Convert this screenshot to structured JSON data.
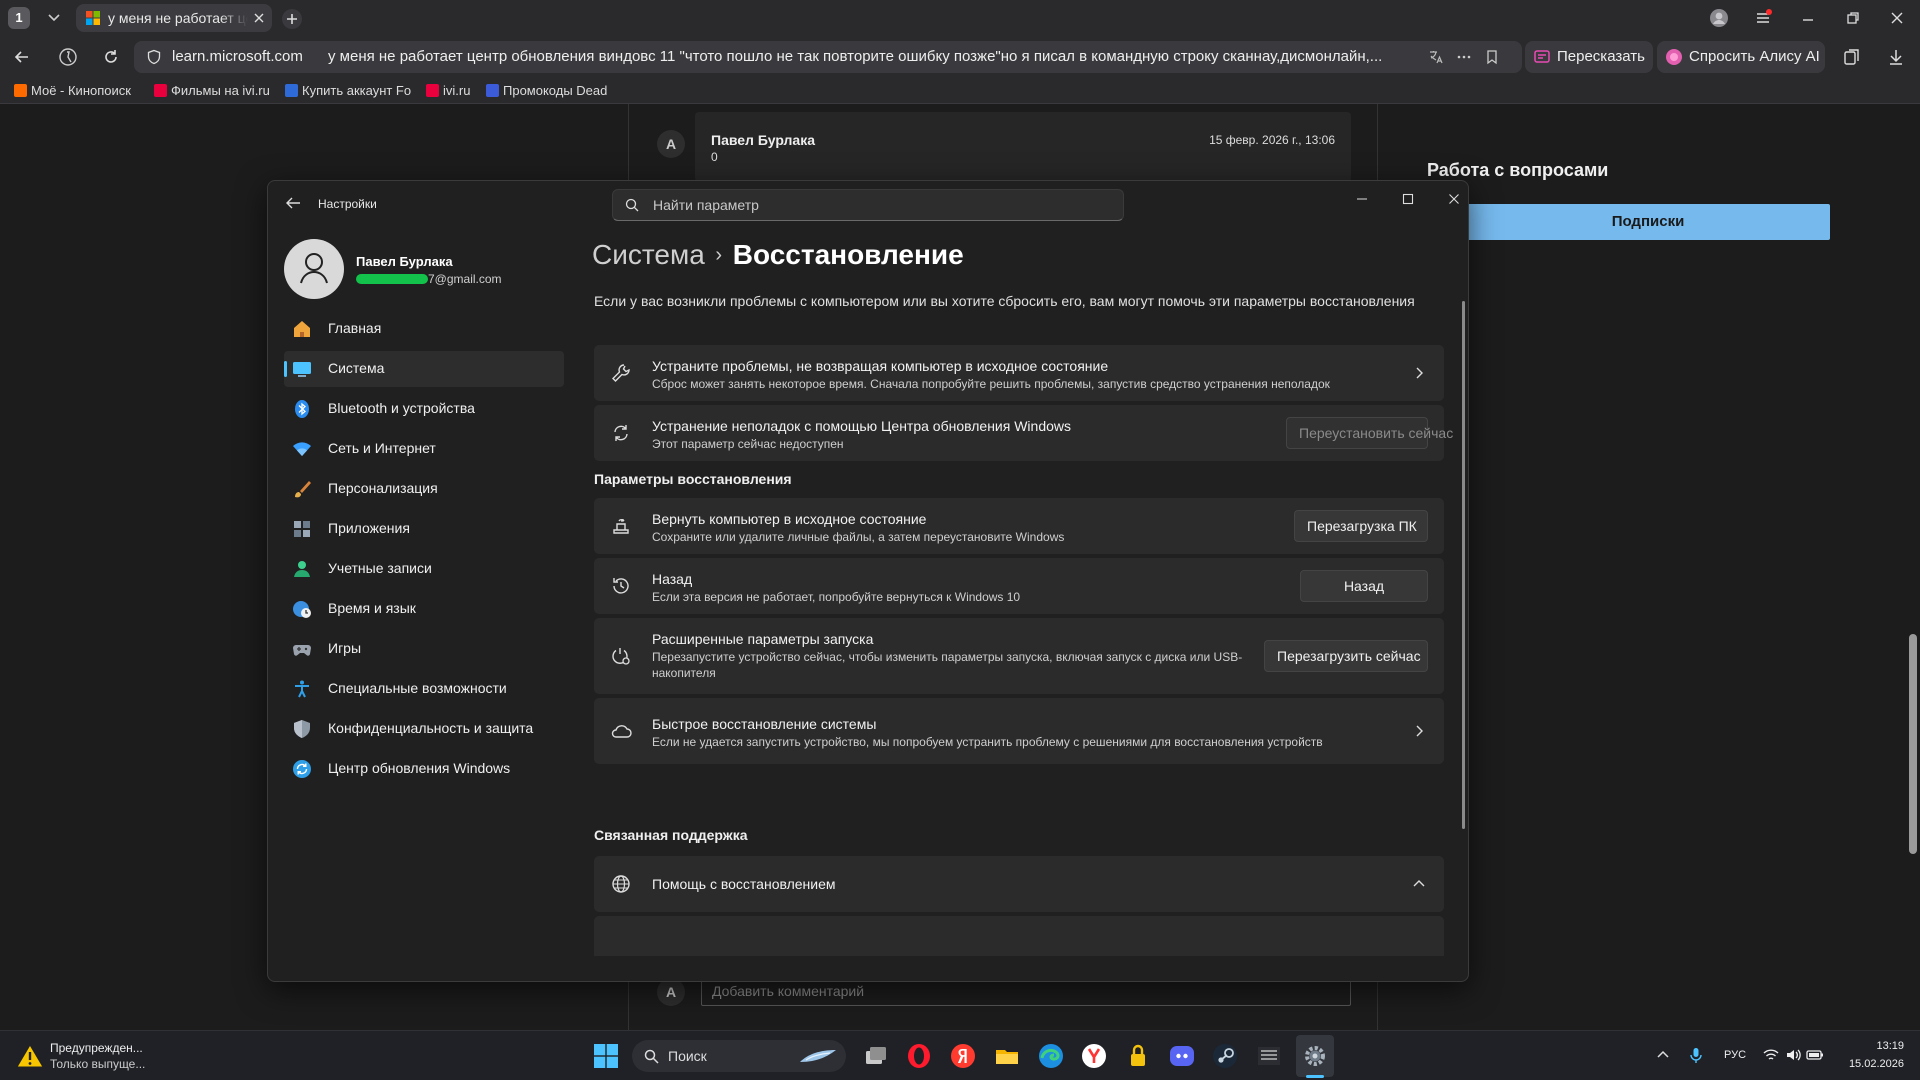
{
  "browser": {
    "tab_count": "1",
    "tab_title": "у меня не работает центр обновления",
    "url_domain": "learn.microsoft.com",
    "url_query": "у меня не работает центр обновления виндовс 11 \"чтото пошло не так повторите ошибку позже\"но я писал в командную строку сканнау,дисмонлайн,...",
    "retell_label": "Пересказать",
    "alice_label": "Спросить Алису AI",
    "bookmarks": [
      {
        "label": "Моё - Кинопоиск",
        "color": "#ff6a00"
      },
      {
        "label": "Фильмы на ivi.ru",
        "color": "#ea003d"
      },
      {
        "label": "Купить аккаунт Fo",
        "color": "#2f6bd8"
      },
      {
        "label": "ivi.ru",
        "color": "#ea003d"
      },
      {
        "label": "Промокоды Dead",
        "color": "#3b5bdb"
      }
    ]
  },
  "page": {
    "comment": {
      "avatar": "A",
      "author": "Павел Бурлака",
      "body": "0",
      "date": "15 февр. 2026 г., 13:06"
    },
    "comment_placeholder": "Добавить комментарий",
    "comment_avatar": "A",
    "questions_heading": "Работа с вопросами",
    "subscriptions_button": "Подписки"
  },
  "settings": {
    "app_title": "Настройки",
    "search_placeholder": "Найти параметр",
    "profile": {
      "name": "Павел Бурлака",
      "email_suffix": "7@gmail.com"
    },
    "nav": [
      {
        "label": "Главная",
        "icon": "home-icon",
        "name": "home"
      },
      {
        "label": "Система",
        "icon": "system-icon",
        "name": "system",
        "active": true
      },
      {
        "label": "Bluetooth и устройства",
        "icon": "bluetooth-icon",
        "name": "bluetooth"
      },
      {
        "label": "Сеть и Интернет",
        "icon": "wifi-icon",
        "name": "network"
      },
      {
        "label": "Персонализация",
        "icon": "brush-icon",
        "name": "personalization"
      },
      {
        "label": "Приложения",
        "icon": "apps-icon",
        "name": "apps"
      },
      {
        "label": "Учетные записи",
        "icon": "account-icon",
        "name": "accounts"
      },
      {
        "label": "Время и язык",
        "icon": "globe-clock-icon",
        "name": "time-language"
      },
      {
        "label": "Игры",
        "icon": "gamepad-icon",
        "name": "gaming"
      },
      {
        "label": "Специальные возможности",
        "icon": "accessibility-icon",
        "name": "accessibility"
      },
      {
        "label": "Конфиденциальность и защита",
        "icon": "shield-icon",
        "name": "privacy"
      },
      {
        "label": "Центр обновления Windows",
        "icon": "update-icon",
        "name": "windows-update"
      }
    ],
    "breadcrumb": {
      "parent": "Система",
      "separator": "›",
      "current": "Восстановление"
    },
    "description": "Если у вас возникли проблемы с компьютером или вы хотите сбросить его, вам могут помочь эти параметры восстановления",
    "fix_card": {
      "title": "Устраните проблемы, не возвращая компьютер в исходное состояние",
      "subtitle": "Сброс может занять некоторое время. Сначала попробуйте решить проблемы, запустив средство устранения неполадок"
    },
    "wu_card": {
      "title": "Устранение неполадок с помощью Центра обновления Windows",
      "subtitle": "Этот параметр сейчас недоступен",
      "button": "Переустановить сейчас"
    },
    "recovery_heading": "Параметры восстановления",
    "reset_card": {
      "title": "Вернуть компьютер в исходное состояние",
      "subtitle": "Сохраните или удалите личные файлы, а затем переустановите Windows",
      "button": "Перезагрузка ПК"
    },
    "goback_card": {
      "title": "Назад",
      "subtitle": "Если эта версия не работает, попробуйте вернуться к Windows 10",
      "button": "Назад"
    },
    "advanced_card": {
      "title": "Расширенные параметры запуска",
      "subtitle": "Перезапустите устройство сейчас, чтобы изменить параметры запуска, включая запуск с диска или USB-накопителя",
      "button": "Перезагрузить сейчас"
    },
    "quick_card": {
      "title": "Быстрое восстановление системы",
      "subtitle": "Если не удается запустить устройство, мы попробуем устранить проблему с решениями для восстановления устройств"
    },
    "support_heading": "Связанная поддержка",
    "help_card": {
      "title": "Помощь с восстановлением"
    }
  },
  "taskbar": {
    "notification_title": "Предупрежден...",
    "notification_subtitle": "Только выпуще...",
    "search_label": "Поиск",
    "language": "РУС",
    "time": "13:19",
    "date": "15.02.2026"
  },
  "colors": {
    "accent": "#4cc2ff",
    "subscribe_button": "#76b9ed",
    "redaction": "#12c24a"
  }
}
